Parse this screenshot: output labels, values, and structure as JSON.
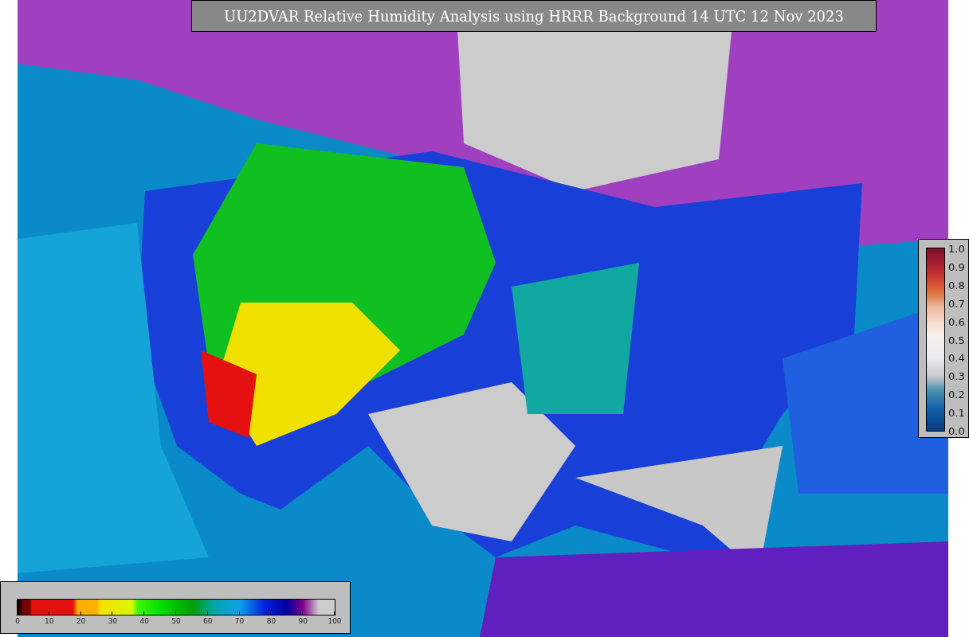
{
  "title": "UU2DVAR Relative Humidity Analysis using HRRR Background 14 UTC 12 Nov 2023",
  "humidity_colorbar": {
    "ticks": [
      "0",
      "10",
      "20",
      "30",
      "40",
      "50",
      "60",
      "70",
      "80",
      "90",
      "100"
    ]
  },
  "observation_colorbar": {
    "ticks": [
      "1.0",
      "0.9",
      "0.8",
      "0.7",
      "0.6",
      "0.5",
      "0.4",
      "0.3",
      "0.2",
      "0.1",
      "0.0"
    ]
  }
}
